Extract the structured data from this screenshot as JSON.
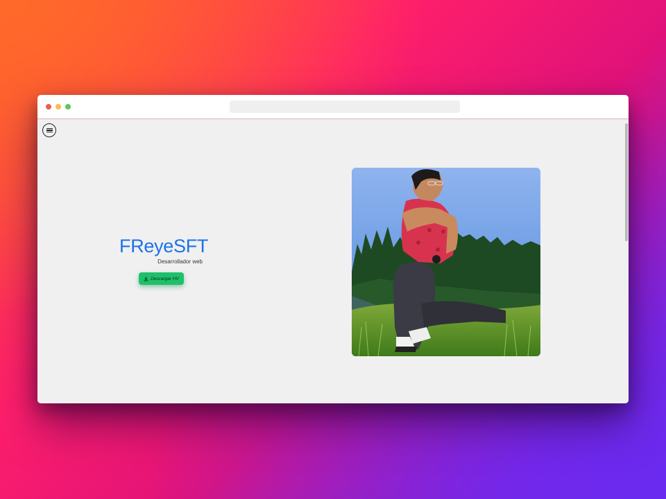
{
  "hero": {
    "title": "FReyeSFT",
    "subtitle": "Desarrollador web",
    "cv_button_label": "Descargar HV"
  },
  "icons": {
    "menu": "hamburger-menu-icon",
    "download": "download-icon"
  },
  "colors": {
    "title": "#1a73e8",
    "cv_button": "#1ec06a",
    "page_background": "#f0f0f0"
  }
}
